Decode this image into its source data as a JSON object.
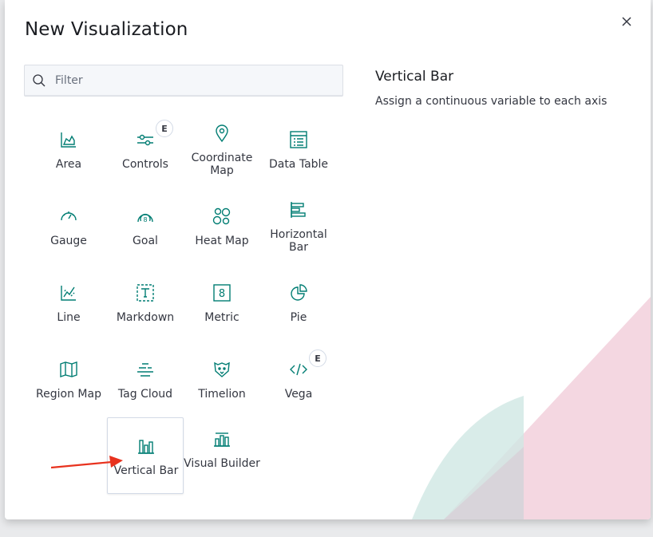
{
  "modal": {
    "title": "New Visualization",
    "close_icon": "close-icon"
  },
  "search": {
    "placeholder": "Filter",
    "value": "",
    "icon": "search-icon"
  },
  "types": [
    {
      "label": "Area",
      "icon": "area-chart-icon"
    },
    {
      "label": "Controls",
      "icon": "controls-sliders-icon",
      "badge": "E"
    },
    {
      "label": "Coordinate Map",
      "icon": "map-pin-icon"
    },
    {
      "label": "Data Table",
      "icon": "table-icon"
    },
    {
      "label": "Gauge",
      "icon": "gauge-icon"
    },
    {
      "label": "Goal",
      "icon": "goal-icon"
    },
    {
      "label": "Heat Map",
      "icon": "heatmap-icon"
    },
    {
      "label": "Horizontal Bar",
      "icon": "horizontal-bar-icon"
    },
    {
      "label": "Line",
      "icon": "line-chart-icon"
    },
    {
      "label": "Markdown",
      "icon": "markdown-icon"
    },
    {
      "label": "Metric",
      "icon": "metric-icon"
    },
    {
      "label": "Pie",
      "icon": "pie-chart-icon"
    },
    {
      "label": "Region Map",
      "icon": "region-map-icon"
    },
    {
      "label": "Tag Cloud",
      "icon": "tag-cloud-icon"
    },
    {
      "label": "Timelion",
      "icon": "timelion-icon"
    },
    {
      "label": "Vega",
      "icon": "code-icon",
      "badge": "E"
    },
    {
      "label": "Vertical Bar",
      "icon": "vertical-bar-icon",
      "selected": true
    },
    {
      "label": "Visual Builder",
      "icon": "visual-builder-icon"
    }
  ],
  "description": {
    "title": "Vertical Bar",
    "text": "Assign a continuous variable to each axis"
  },
  "colors": {
    "accent": "#017d73",
    "annotation_arrow": "#e8321e"
  }
}
